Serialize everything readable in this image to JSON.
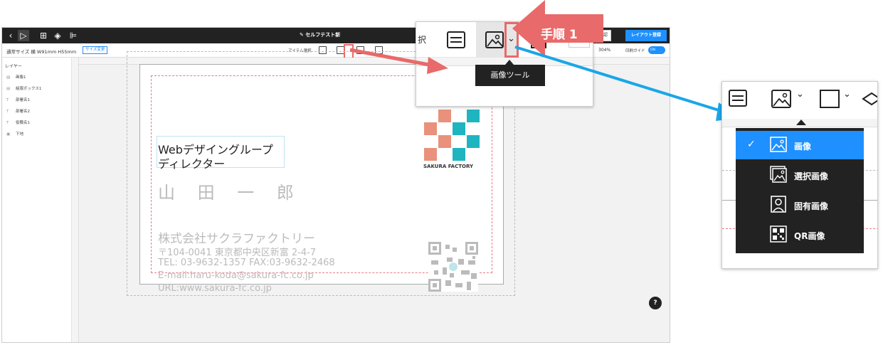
{
  "editor": {
    "doc_title": "✎ セルフテスト新",
    "preview_button": "仕上がり確認",
    "register_button": "レイアウト登録",
    "size_label": "通常サイズ 横 W91mm H55mm",
    "size_change_button": "サイズ変更",
    "item_select_label": "アイテム選択",
    "zoom": "304%",
    "print_guide_label": "印刷ガイド",
    "toggle_state": "ON"
  },
  "layers": {
    "heading": "レイヤー",
    "items": [
      {
        "icon": "image",
        "label": "画像1"
      },
      {
        "icon": "text-box",
        "label": "組版ボックス1"
      },
      {
        "icon": "text",
        "label": "部署名1"
      },
      {
        "icon": "text",
        "label": "部署名2"
      },
      {
        "icon": "text",
        "label": "役職名1"
      },
      {
        "icon": "background",
        "label": "下地"
      }
    ]
  },
  "card": {
    "dept_line1": "Webデザイングループ",
    "dept_line2": "ディレクター",
    "name": "山 田 一 郎",
    "company": "株式会社サクラファクトリー",
    "address": "〒104-0041 東京都中央区新富 2-4-7",
    "phone": "TEL: 03-9632-1357 FAX:03-9632-2468",
    "email": "E-mail:haru-koda@sakura-fc.co.jp",
    "url": "URL:www.sakura-fc.co.jp",
    "logo_text": "SAKURA FACTORY",
    "colors": {
      "coral": "#e9917b",
      "teal": "#1fb5c0"
    }
  },
  "callout": {
    "step_label": "手順 1",
    "tooltip": "画像ツール",
    "partial_label": "択",
    "arrow_color": "#e86a6a"
  },
  "image_menu": {
    "items": [
      {
        "label": "画像",
        "icon": "image-icon",
        "selected": true
      },
      {
        "label": "選択画像",
        "icon": "selected-image-icon",
        "selected": false
      },
      {
        "label": "固有画像",
        "icon": "person-image-icon",
        "selected": false
      },
      {
        "label": "QR画像",
        "icon": "qr-icon",
        "selected": false
      }
    ],
    "selected_color": "#1e90ff",
    "connector_color": "#1aa6e8"
  },
  "help": "?"
}
